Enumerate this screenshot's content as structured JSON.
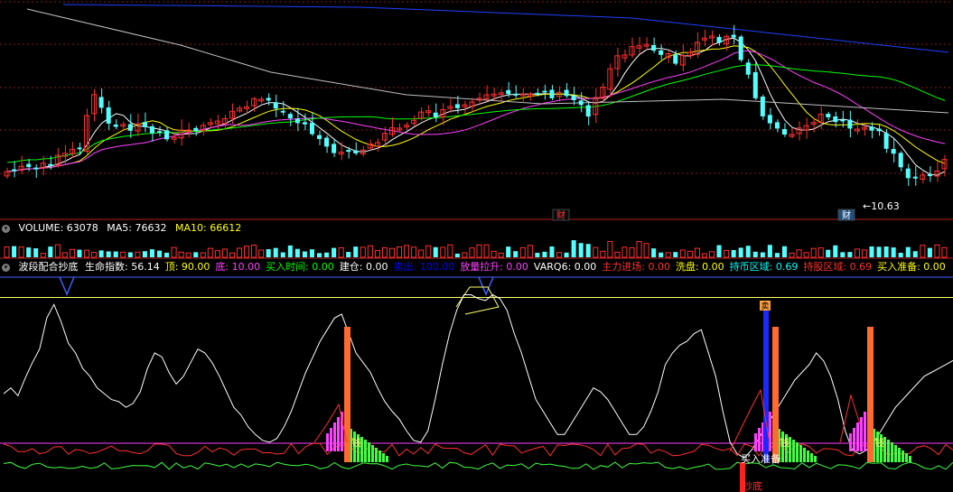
{
  "price_panel": {
    "low_label": "10.63",
    "markers": [
      {
        "text": "财",
        "color": "#ff3b3b",
        "bg": "#0b0b0b"
      },
      {
        "text": "财",
        "color": "#ffffff",
        "bg": "#1f4f7f"
      }
    ]
  },
  "volume_header": {
    "volume": "VOLUME: 63078",
    "ma5": "MA5: 76632",
    "ma10": "MA10: 66612"
  },
  "indicator_header": {
    "name": "波段配合抄底",
    "items": [
      {
        "text": "生命指数: 56.14",
        "color": "#ffffff"
      },
      {
        "text": "顶: 90.00",
        "color": "#ffff00"
      },
      {
        "text": "底: 10.00",
        "color": "#ff40ff"
      },
      {
        "text": "买入时间: 0.00",
        "color": "#00ff00"
      },
      {
        "text": "建仓: 0.00",
        "color": "#ffffff"
      },
      {
        "text": "卖出: 100.00",
        "color": "#0000ff"
      },
      {
        "text": "放量拉升: 0.00",
        "color": "#ff40ff"
      },
      {
        "text": "VARQ6: 0.00",
        "color": "#ffffff"
      },
      {
        "text": "主力进场: 0.00",
        "color": "#ff3030"
      },
      {
        "text": "洗盘: 0.00",
        "color": "#ffff00"
      },
      {
        "text": "持币区域: 0.69",
        "color": "#00ffff"
      },
      {
        "text": "持股区域: 0.69",
        "color": "#ff3030"
      },
      {
        "text": "买入准备: 0.00",
        "color": "#ffff00"
      }
    ]
  },
  "indicator_labels": {
    "chao_di": "抄底",
    "mai_ru_zhun_bei": "买入准备",
    "mai": "卖",
    "qian": "钱"
  },
  "colors": {
    "up": "#ff3030",
    "down": "#54ffff",
    "ma_fast": "#ffffff",
    "ma_mid": "#ffff00",
    "ma_slow": "#ff40ff",
    "ma_long": "#00ff00",
    "ma_longest": "#2040ff",
    "grid": "#8b1a1a"
  },
  "chart_data": [
    {
      "type": "candlestick",
      "title": "",
      "price_low_label": 10.63,
      "series": [
        {
          "name": "",
          "color": "#2040ff",
          "values": [
            [
              0,
              0
            ],
            [
              1,
              1
            ]
          ]
        }
      ]
    },
    {
      "type": "bar",
      "title": "VOLUME",
      "series": [
        {
          "name": "VOLUME",
          "values": [
            63078
          ]
        },
        {
          "name": "MA5",
          "values": [
            76632
          ]
        },
        {
          "name": "MA10",
          "values": [
            66612
          ]
        }
      ]
    },
    {
      "type": "line",
      "title": "波段配合抄底",
      "ylim": [
        0,
        100
      ],
      "reference_lines": {
        "顶": 90.0,
        "底": 10.0
      },
      "series": [
        {
          "name": "生命指数",
          "last": 56.14,
          "values": [
            39,
            42,
            38,
            47,
            55,
            62,
            78,
            85,
            76,
            65,
            60,
            52,
            48,
            42,
            39,
            36,
            35,
            32,
            34,
            40,
            52,
            60,
            58,
            50,
            44,
            48,
            55,
            62,
            60,
            55,
            48,
            40,
            32,
            28,
            22,
            18,
            15,
            14,
            16,
            22,
            30,
            40,
            50,
            58,
            66,
            72,
            78,
            80,
            70,
            60,
            55,
            50,
            42,
            35,
            30,
            26,
            20,
            15,
            14,
            20,
            36,
            54,
            70,
            82,
            90,
            90,
            88,
            87,
            90,
            88,
            82,
            70,
            60,
            48,
            36,
            30,
            24,
            18,
            18,
            24,
            30,
            36,
            42,
            40,
            36,
            30,
            24,
            18,
            18,
            22,
            30,
            40,
            54,
            60,
            64,
            66,
            70,
            72,
            60,
            48,
            30,
            14,
            8,
            6,
            10,
            16,
            22,
            28,
            34,
            40,
            46,
            50,
            54,
            60,
            56,
            48,
            36,
            20,
            10,
            8,
            10,
            14,
            20,
            26,
            32,
            36,
            40,
            44,
            48,
            50,
            52,
            54,
            56.14
          ]
        }
      ]
    }
  ]
}
